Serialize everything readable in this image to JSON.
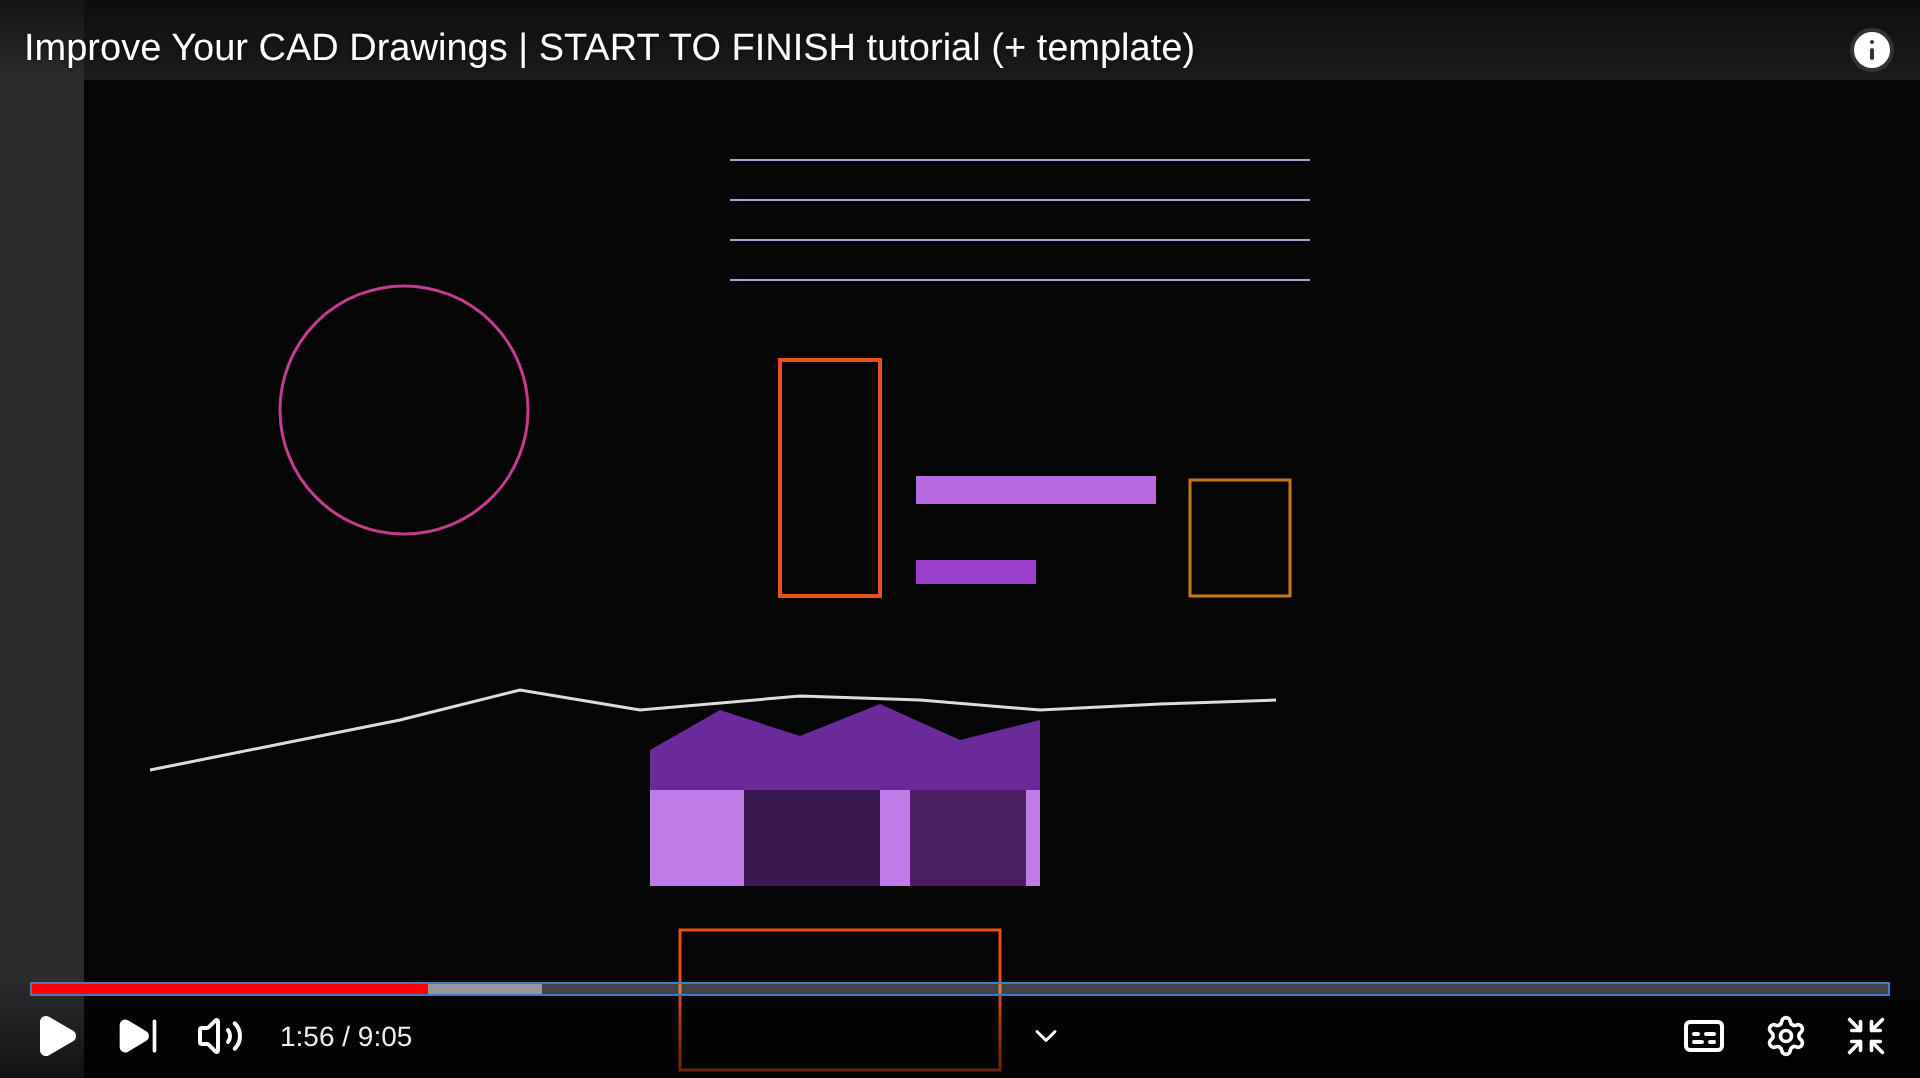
{
  "video": {
    "kind": "picture",
    "title": "Improve Your CAD Drawings | START TO FINISH tutorial (+ template)"
  },
  "progress": {
    "level": 0.213
  },
  "buffer": {
    "level": 0.275
  },
  "time": "1:56 / 9:05"
}
